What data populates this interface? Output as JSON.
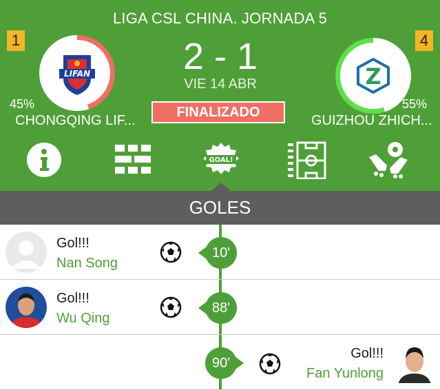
{
  "match": {
    "league": "LIGA CSL CHINA. JORNADA 5",
    "score": "2 - 1",
    "date": "VIE 14 ABR",
    "status": "FINALIZADO"
  },
  "home": {
    "rank": "1",
    "percent": "45%",
    "possession_fraction": 0.45,
    "name": "CHONGQING LIF...",
    "logo_text": "LIFAN"
  },
  "away": {
    "rank": "4",
    "percent": "55%",
    "possession_fraction": 0.55,
    "name": "GUIZHOU ZHICH...",
    "logo_text": "Z"
  },
  "tabs": [
    {
      "icon": "info-icon"
    },
    {
      "icon": "lineup-icon"
    },
    {
      "icon": "goal-badge-icon",
      "label": "GOAL!",
      "active": true
    },
    {
      "icon": "field-icon"
    },
    {
      "icon": "boots-icon"
    }
  ],
  "section": {
    "title": "GOLES"
  },
  "goals": [
    {
      "side": "home",
      "label": "Gol!!!",
      "player": "Nan Song",
      "minute": "10'"
    },
    {
      "side": "home",
      "label": "Gol!!!",
      "player": "Wu Qing",
      "minute": "88'"
    },
    {
      "side": "away",
      "label": "Gol!!!",
      "player": "Fan Yunlong",
      "minute": "90'"
    }
  ],
  "colors": {
    "green": "#4f9f38",
    "red": "#f06e63",
    "home_ring": "#f06e63",
    "away_ring": "#5de04a",
    "rank": "#f2b523",
    "section": "#5e5e5e"
  }
}
